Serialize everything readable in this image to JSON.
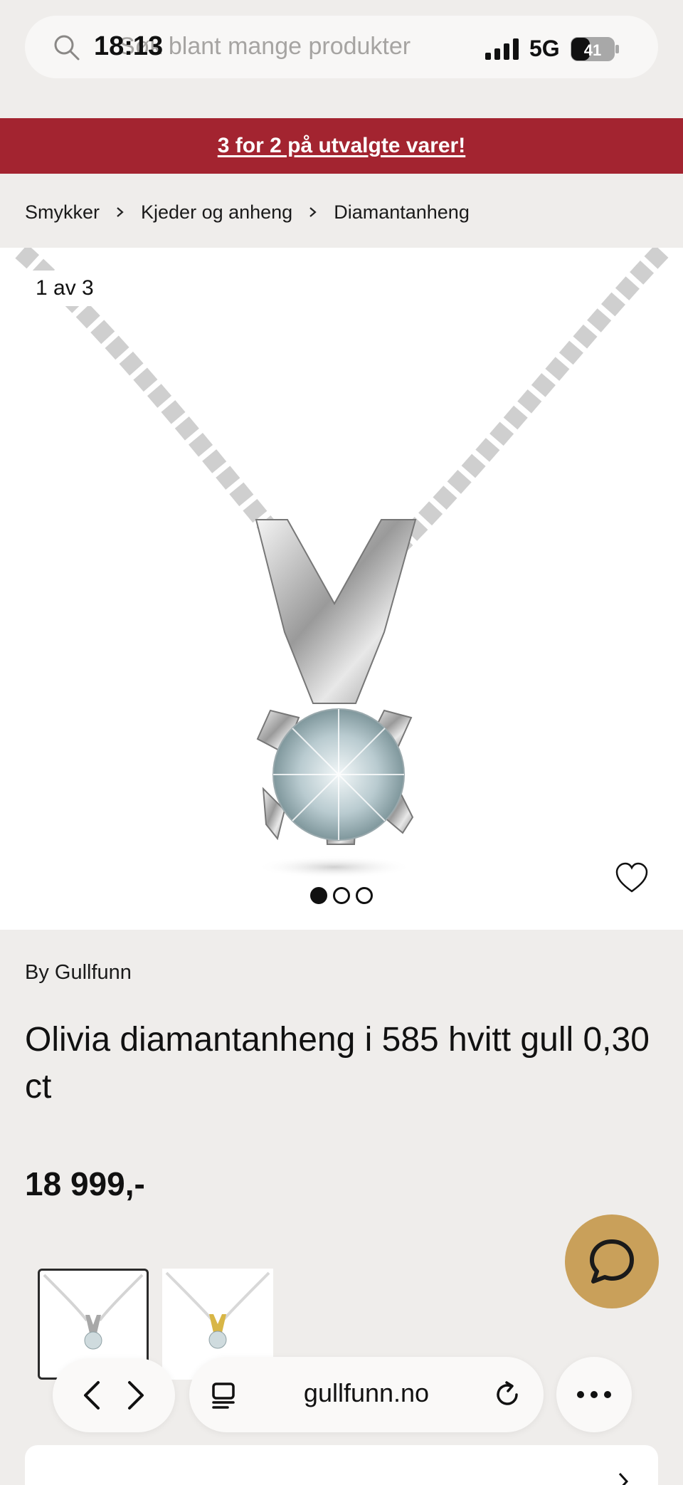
{
  "status_bar": {
    "time": "18:13",
    "network": "5G",
    "battery": "41"
  },
  "search": {
    "placeholder": "Søk blant mange produkter"
  },
  "promo": {
    "text": "3 for 2 på utvalgte varer!"
  },
  "breadcrumb": {
    "items": [
      "Smykker",
      "Kjeder og anheng",
      "Diamantanheng"
    ]
  },
  "gallery": {
    "counter": "1 av 3",
    "active_index": 0,
    "total": 3
  },
  "product": {
    "brand": "By Gullfunn",
    "title": "Olivia diamantanheng i 585 hvitt gull 0,30 ct",
    "price": "18 999,-"
  },
  "variants": [
    {
      "metal": "white-gold",
      "selected": true
    },
    {
      "metal": "yellow-gold",
      "selected": false
    }
  ],
  "browser": {
    "url": "gullfunn.no"
  },
  "colors": {
    "promo_bg": "#a32430",
    "chat_fab": "#c9a05a",
    "page_bg": "#efedeb"
  }
}
